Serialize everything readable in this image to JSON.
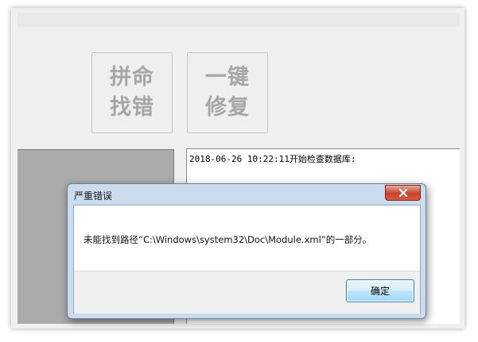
{
  "toolbar": {
    "pin_button_line1": "拼命",
    "pin_button_line2": "找错",
    "fix_button_line1": "一键",
    "fix_button_line2": "修复"
  },
  "log": {
    "lines": [
      "2018-06-26 10:22:11开始检查数据库:"
    ]
  },
  "dialog": {
    "title": "严重错误",
    "message": "未能找到路径“C:\\Windows\\system32\\Doc\\Module.xml”的一部分。",
    "ok_label": "确定",
    "close_icon": "close-icon"
  },
  "colors": {
    "close_button": "#c9422d",
    "ok_button_border": "#3c7fb1",
    "dialog_frame": "#cbdcee"
  }
}
